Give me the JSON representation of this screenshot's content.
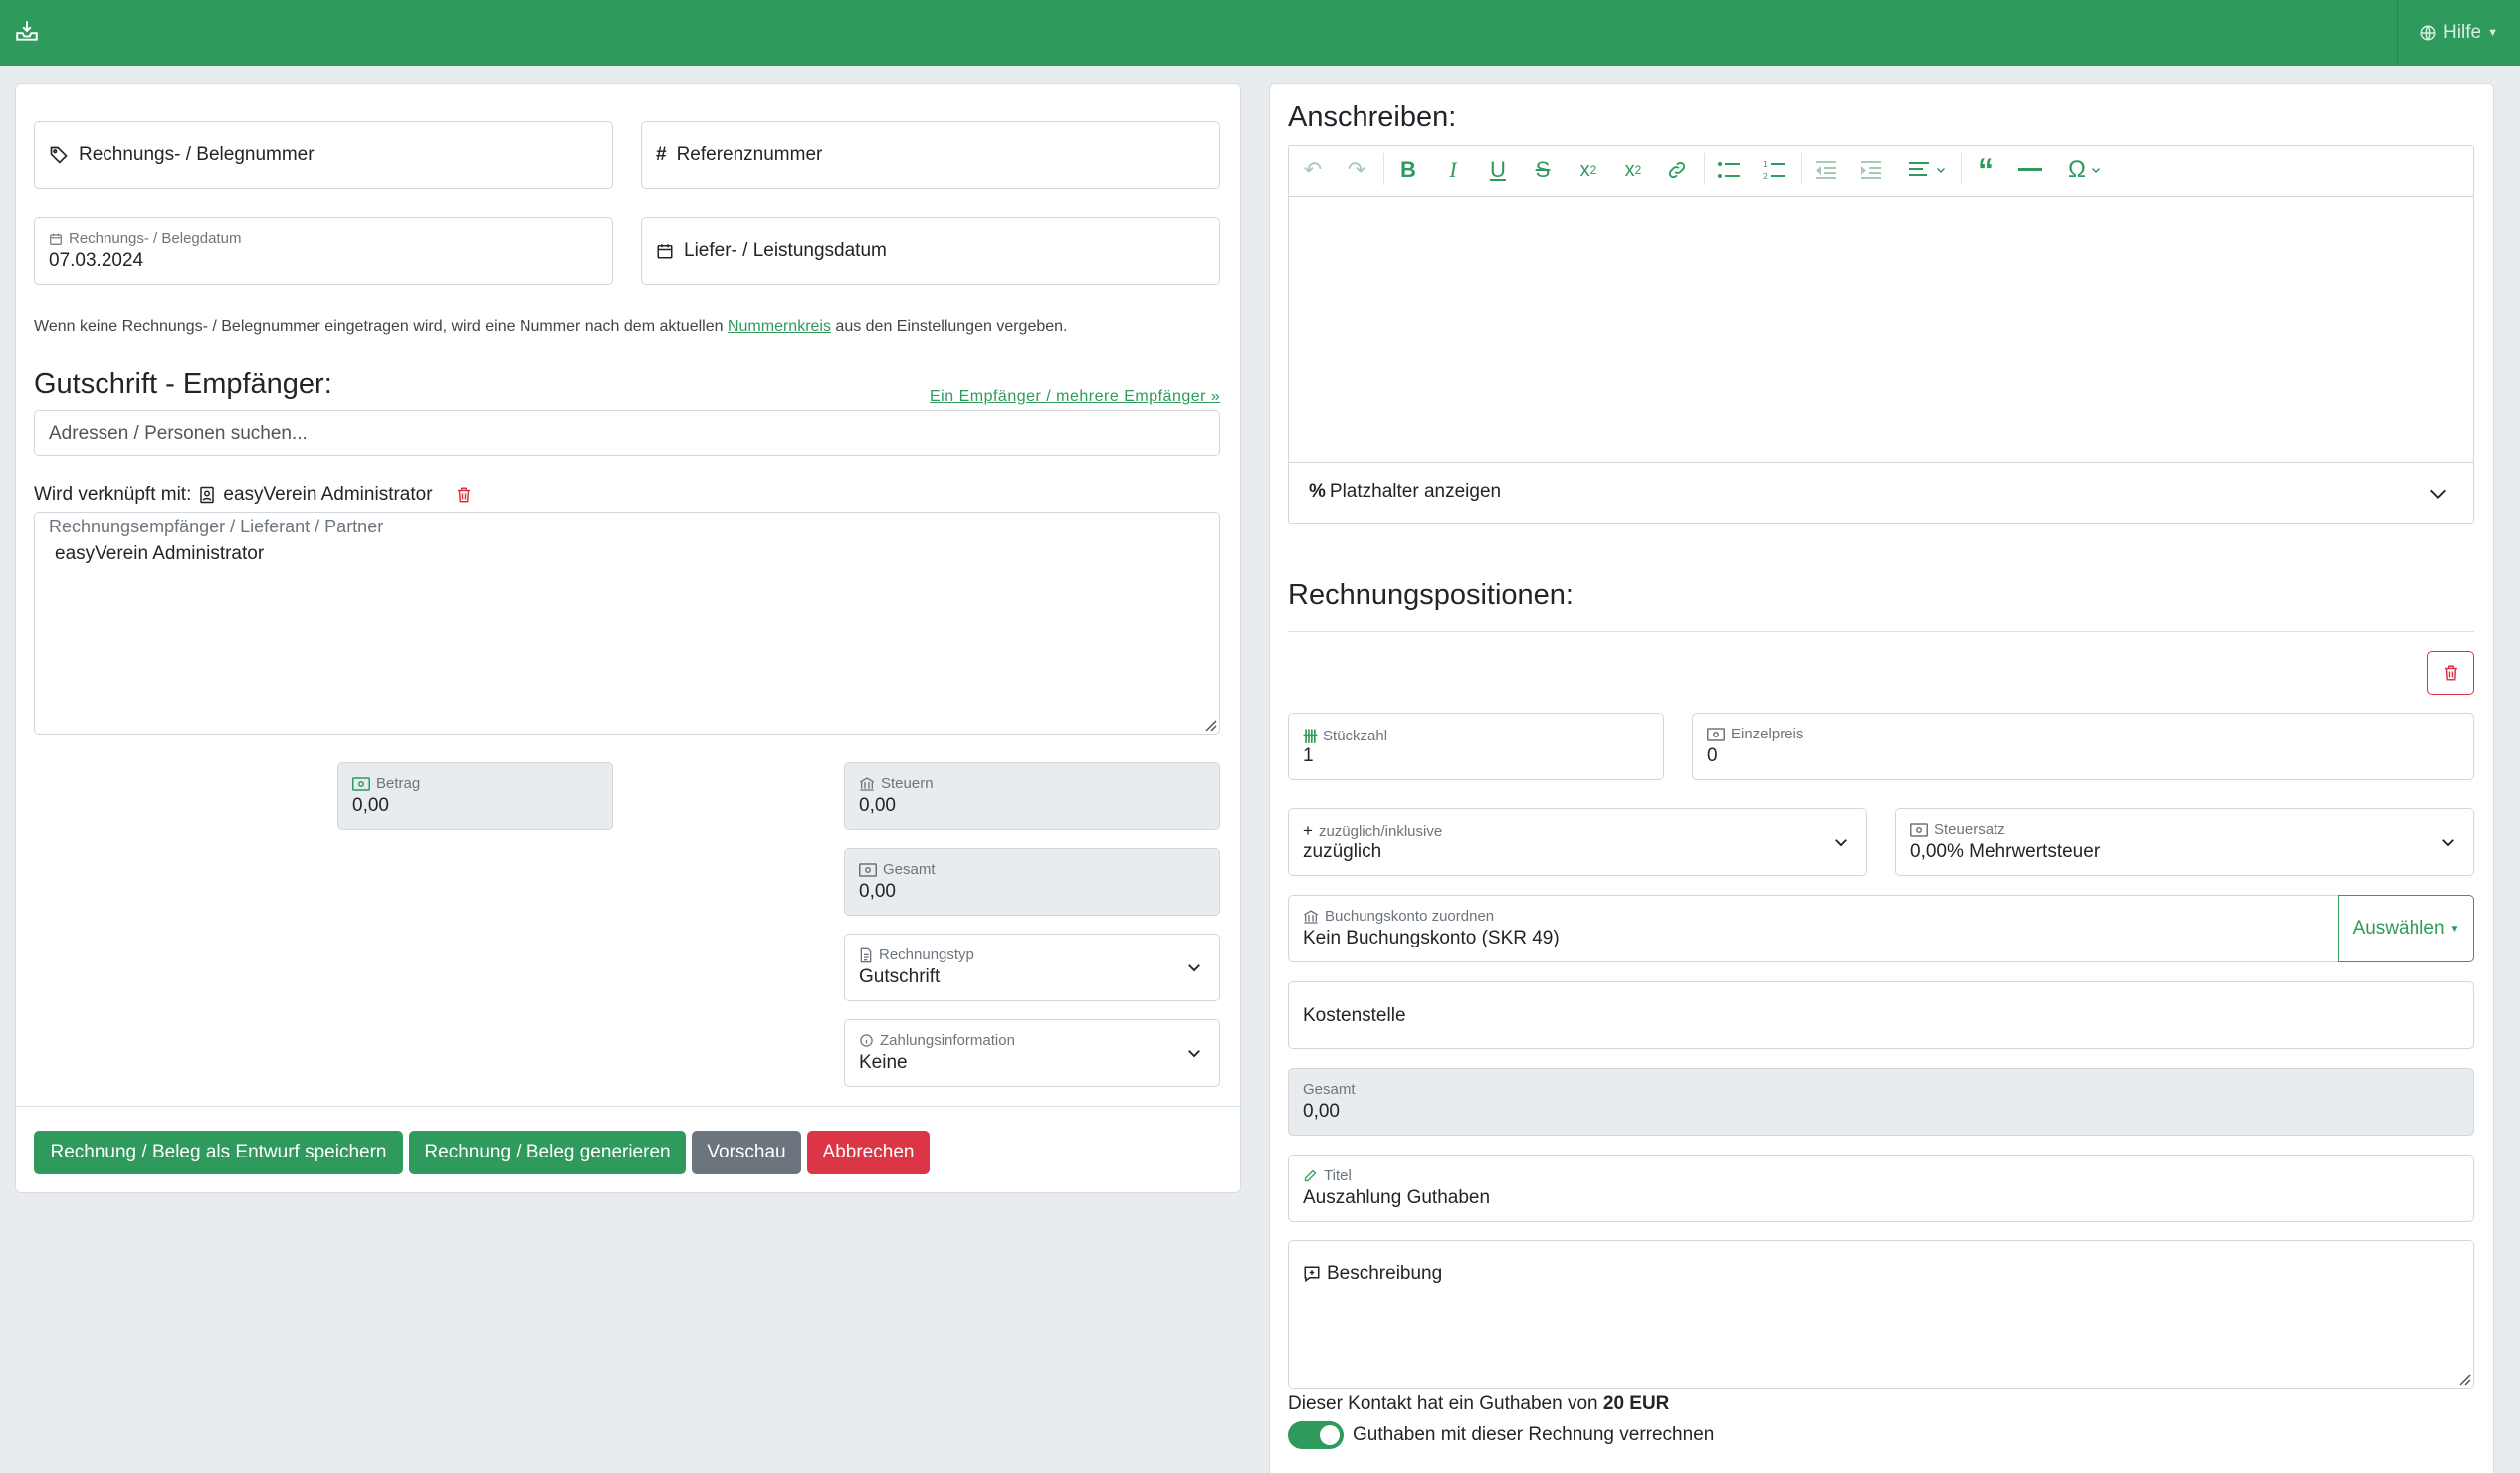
{
  "topbar": {
    "help_label": "Hilfe",
    "home_icon": "home-tray-icon"
  },
  "left": {
    "invoice_number_placeholder": "Rechnungs- / Belegnummer",
    "reference_placeholder": "Referenznummer",
    "invoice_date_label": "Rechnungs- / Belegdatum",
    "invoice_date_value": "07.03.2024",
    "delivery_date_placeholder": "Liefer- / Leistungsdatum",
    "hint_before": "Wenn keine Rechnungs- / Belegnummer eingetragen wird, wird eine Nummer nach dem aktuellen ",
    "hint_link": "Nummernkreis",
    "hint_after": " aus den Einstellungen vergeben.",
    "recipient_heading": "Gutschrift - Empfänger:",
    "recipient_toggle_link": "Ein Empfänger / mehrere Empfänger »",
    "search_placeholder": "Adressen / Personen suchen...",
    "linked_prefix": "Wird verknüpft mit:",
    "linked_name": "easyVerein Administrator",
    "address_label": "Rechnungsempfänger / Lieferant / Partner",
    "address_value": "easyVerein Administrator",
    "amount_label": "Betrag",
    "amount_value": "0,00",
    "taxes_label": "Steuern",
    "taxes_value": "0,00",
    "total_label": "Gesamt",
    "total_value": "0,00",
    "type_label": "Rechnungstyp",
    "type_value": "Gutschrift",
    "payment_label": "Zahlungsinformation",
    "payment_value": "Keine",
    "buttons": {
      "save_draft": "Rechnung / Beleg als Entwurf speichern",
      "generate": "Rechnung / Beleg generieren",
      "preview": "Vorschau",
      "cancel": "Abbrechen"
    }
  },
  "right": {
    "letter_heading": "Anschreiben:",
    "placeholder_toggle": "Platzhalter anzeigen",
    "positions_heading": "Rechnungspositionen:",
    "qty_label": "Stückzahl",
    "qty_value": "1",
    "unit_price_label": "Einzelpreis",
    "unit_price_value": "0",
    "inclusive_label": "zuzüglich/inklusive",
    "inclusive_value": "zuzüglich",
    "tax_rate_label": "Steuersatz",
    "tax_rate_value": "0,00% Mehrwertsteuer",
    "account_label": "Buchungskonto zuordnen",
    "account_value": "Kein Buchungskonto (SKR 49)",
    "select_button": "Auswählen",
    "cost_center_placeholder": "Kostenstelle",
    "pos_total_label": "Gesamt",
    "pos_total_value": "0,00",
    "title_label": "Titel",
    "title_value": "Auszahlung Guthaben",
    "description_placeholder": "Beschreibung",
    "credit_text_before": "Dieser Kontakt hat ein Guthaben von ",
    "credit_amount": "20 EUR",
    "credit_toggle_label": "Guthaben mit dieser Rechnung verrechnen",
    "credit_toggle_on": true
  },
  "colors": {
    "primary": "#2e9a5b",
    "danger": "#dc3545",
    "secondary": "#6c757d",
    "background": "#e9ecef"
  }
}
